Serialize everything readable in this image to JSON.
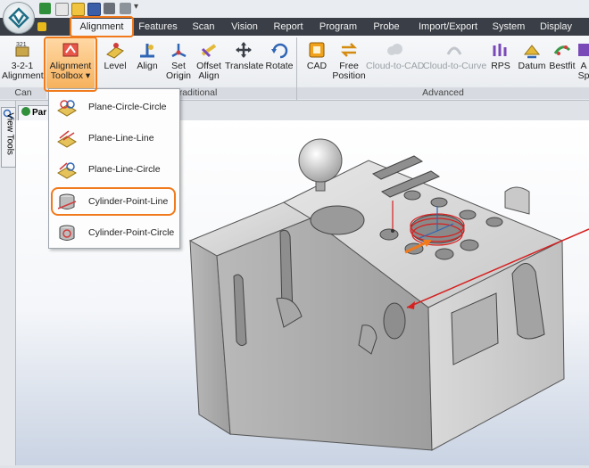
{
  "quick_access": [
    "new-icon",
    "open-icon",
    "save-icon",
    "tools-icon",
    "print-icon"
  ],
  "tabs": [
    {
      "id": "alignment",
      "label": "Alignment",
      "active": true
    },
    {
      "id": "features",
      "label": "Features"
    },
    {
      "id": "scan",
      "label": "Scan"
    },
    {
      "id": "vision",
      "label": "Vision"
    },
    {
      "id": "report",
      "label": "Report"
    },
    {
      "id": "program",
      "label": "Program"
    },
    {
      "id": "probe",
      "label": "Probe"
    },
    {
      "id": "import-export",
      "label": "Import/Export"
    },
    {
      "id": "system",
      "label": "System"
    },
    {
      "id": "display",
      "label": "Display"
    }
  ],
  "ribbon": {
    "buttons": [
      {
        "id": "3-2-1",
        "line1": "3-2-1",
        "line2": "Alignment",
        "icon": "321-alignment-icon"
      },
      {
        "id": "toolbox",
        "line1": "Alignment",
        "line2": "Toolbox ▾",
        "icon": "alignment-toolbox-icon",
        "highlighted": true
      },
      {
        "id": "level",
        "line1": "Level",
        "line2": "",
        "icon": "level-icon"
      },
      {
        "id": "align",
        "line1": "Align",
        "line2": "",
        "icon": "align-icon"
      },
      {
        "id": "set-origin",
        "line1": "Set",
        "line2": "Origin",
        "icon": "set-origin-icon"
      },
      {
        "id": "offset-align",
        "line1": "Offset",
        "line2": "Align",
        "icon": "offset-align-icon"
      },
      {
        "id": "translate",
        "line1": "Translate",
        "line2": "",
        "icon": "translate-icon"
      },
      {
        "id": "rotate",
        "line1": "Rotate",
        "line2": "",
        "icon": "rotate-icon"
      },
      {
        "id": "cad",
        "line1": "CAD",
        "line2": "",
        "icon": "cad-icon"
      },
      {
        "id": "free-position",
        "line1": "Free",
        "line2": "Position",
        "icon": "free-position-icon"
      },
      {
        "id": "cloud-to-cad",
        "line1": "Cloud-to-CAD",
        "line2": "",
        "icon": "cloud-to-cad-icon",
        "disabled": true
      },
      {
        "id": "cloud-to-curve",
        "line1": "Cloud-to-Curve",
        "line2": "",
        "icon": "cloud-to-curve-icon",
        "disabled": true
      },
      {
        "id": "rps",
        "line1": "RPS",
        "line2": "",
        "icon": "rps-icon"
      },
      {
        "id": "datum",
        "line1": "Datum",
        "line2": "",
        "icon": "datum-icon"
      },
      {
        "id": "bestfit",
        "line1": "Bestfit",
        "line2": "",
        "icon": "bestfit-icon"
      },
      {
        "id": "partial",
        "line1": "A",
        "line2": "Sp",
        "icon": "partial-icon"
      }
    ],
    "groups": [
      {
        "id": "can",
        "label": "Can"
      },
      {
        "id": "traditional",
        "label": "Traditional"
      },
      {
        "id": "advanced",
        "label": "Advanced"
      }
    ]
  },
  "side_panel": {
    "view_tools_label": "View Tools"
  },
  "doc_tab": {
    "label": "Par"
  },
  "toolbox_menu": [
    {
      "label": "Plane-Circle-Circle",
      "icon": "plane-circle-circle-icon"
    },
    {
      "label": "Plane-Line-Line",
      "icon": "plane-line-line-icon"
    },
    {
      "label": "Plane-Line-Circle",
      "icon": "plane-line-circle-icon"
    },
    {
      "label": "Cylinder-Point-Line",
      "icon": "cylinder-point-line-icon",
      "highlighted": true
    },
    {
      "label": "Cylinder-Point-Circle",
      "icon": "cylinder-point-circle-icon"
    }
  ],
  "colors": {
    "accent": "#f07a1c",
    "tabbar": "#3a3f47",
    "measure_line": "#d62020",
    "part": "#d0d0d0"
  }
}
